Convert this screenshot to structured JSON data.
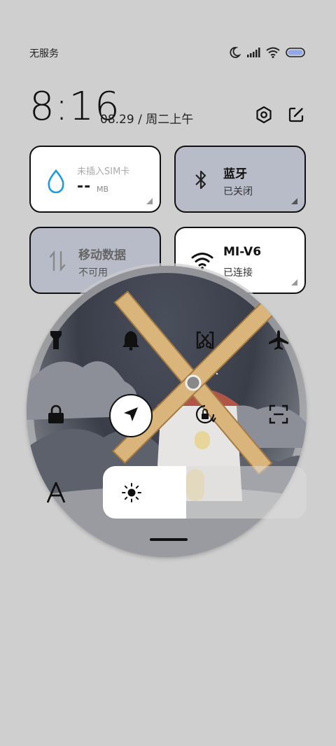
{
  "status_bar": {
    "carrier": "无服务",
    "icons": [
      "moon-icon",
      "signal-icon",
      "wifi-icon",
      "battery-icon"
    ]
  },
  "header": {
    "time": "8:16",
    "date": "08.29 / 周二上午",
    "icons": [
      "settings-icon",
      "edit-icon"
    ]
  },
  "tiles": {
    "data_usage": {
      "title": "未插入SIM卡",
      "value": "--",
      "unit": "MB",
      "icon": "water-drop-icon"
    },
    "bluetooth": {
      "title": "蓝牙",
      "status": "已关闭",
      "icon": "bluetooth-icon"
    },
    "mobile_data": {
      "title": "移动数据",
      "status": "不可用",
      "icon": "data-arrows-icon"
    },
    "wifi": {
      "title": "MI-V6",
      "status": "已连接",
      "icon": "wifi-icon"
    }
  },
  "quick_toggles": [
    "flashlight-icon",
    "bell-icon",
    "screenshot-icon",
    "airplane-icon",
    "lock-icon",
    "location-icon",
    "rotation-lock-icon",
    "scan-icon",
    "font-size-icon"
  ],
  "brightness": {
    "level": 0.41,
    "icon": "sun-icon"
  },
  "colors": {
    "tile_active": "#ffffff",
    "tile_inactive": "#b8bcc8",
    "background": "#cfcfcf",
    "accent_drop": "#1e9be0"
  }
}
